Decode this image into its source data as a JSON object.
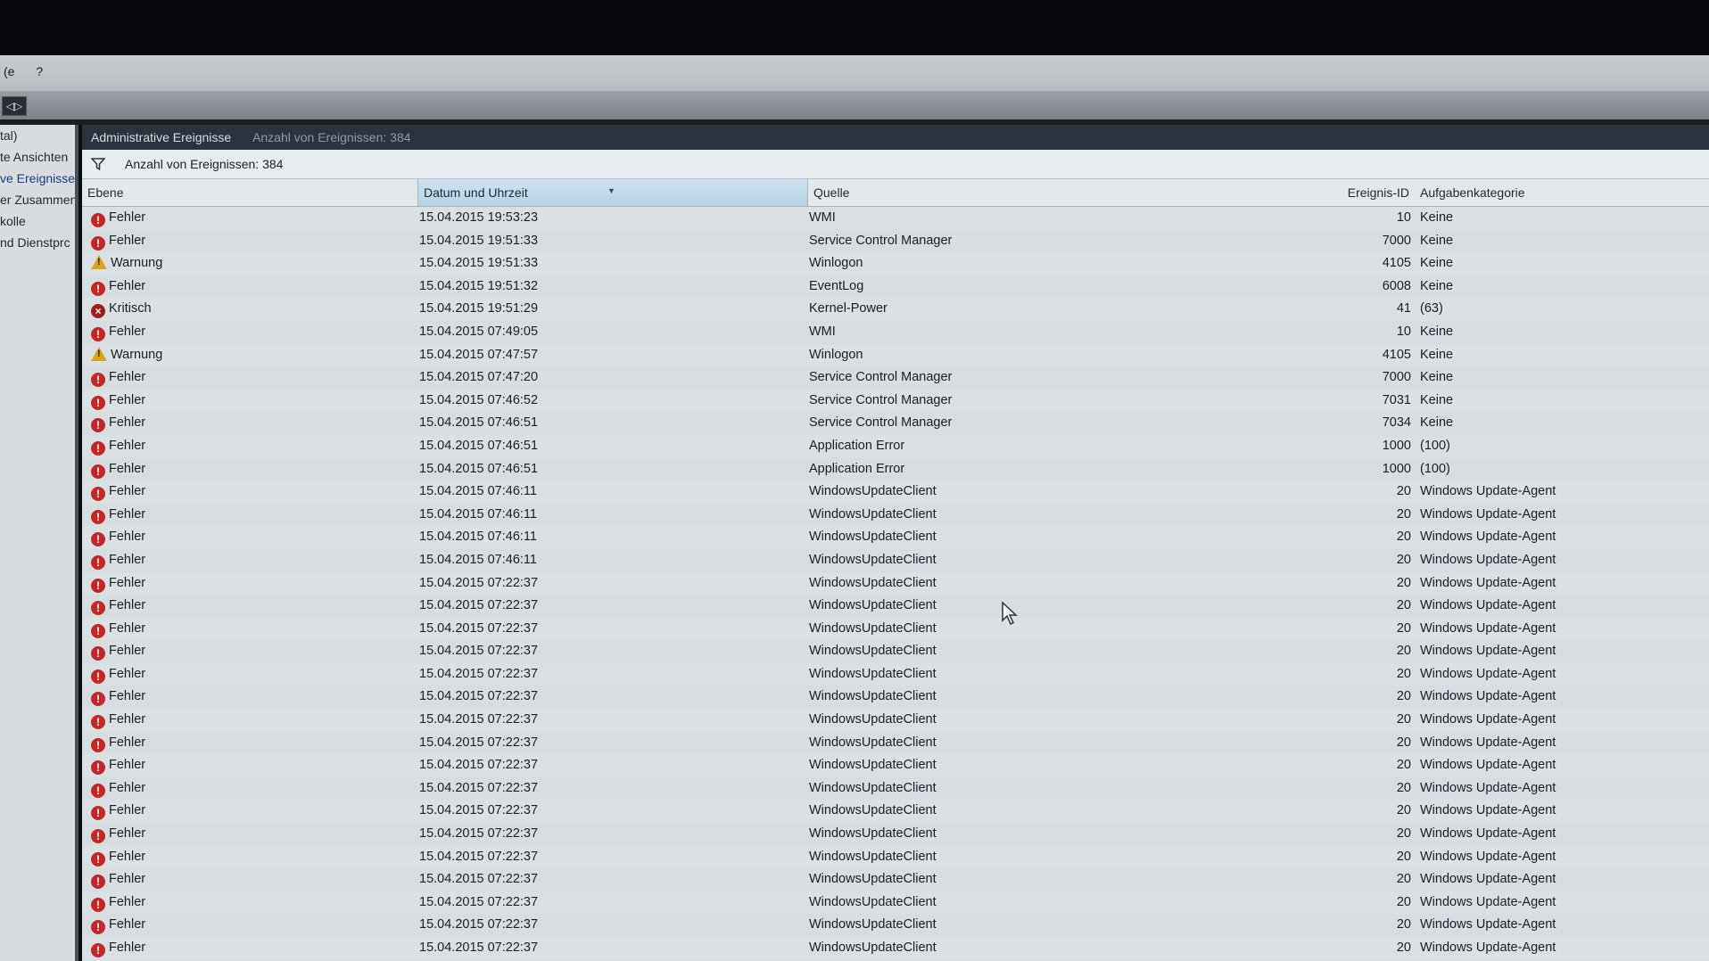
{
  "menubar": {
    "items": [
      "(e",
      "?"
    ]
  },
  "toolbar": {
    "button_label": "◁▷"
  },
  "sidebar": {
    "items": [
      {
        "label": "tal)"
      },
      {
        "label": "te Ansichten"
      },
      {
        "label": "ve Ereignisse"
      },
      {
        "label": "er Zusammen"
      },
      {
        "label": "kolle"
      },
      {
        "label": "nd Dienstprc"
      }
    ]
  },
  "header": {
    "title": "Administrative Ereignisse",
    "subtitle": "Anzahl von Ereignissen: 384"
  },
  "filter": {
    "count_text": "Anzahl von Ereignissen: 384"
  },
  "columns": {
    "level": "Ebene",
    "date": "Datum und Uhrzeit",
    "source": "Quelle",
    "id": "Ereignis-ID",
    "category": "Aufgabenkategorie"
  },
  "level_icons": {
    "Fehler": "error-icon",
    "Warnung": "warning-icon",
    "Kritisch": "critical-icon"
  },
  "colors": {
    "error": "#c0282a",
    "warning": "#d9a520",
    "critical": "#9a1f1f",
    "sorted_header": "#b4d2e4"
  },
  "rows": [
    {
      "level": "Fehler",
      "date": "15.04.2015 19:53:23",
      "source": "WMI",
      "id": "10",
      "category": "Keine"
    },
    {
      "level": "Fehler",
      "date": "15.04.2015 19:51:33",
      "source": "Service Control Manager",
      "id": "7000",
      "category": "Keine"
    },
    {
      "level": "Warnung",
      "date": "15.04.2015 19:51:33",
      "source": "Winlogon",
      "id": "4105",
      "category": "Keine"
    },
    {
      "level": "Fehler",
      "date": "15.04.2015 19:51:32",
      "source": "EventLog",
      "id": "6008",
      "category": "Keine"
    },
    {
      "level": "Kritisch",
      "date": "15.04.2015 19:51:29",
      "source": "Kernel-Power",
      "id": "41",
      "category": "(63)"
    },
    {
      "level": "Fehler",
      "date": "15.04.2015 07:49:05",
      "source": "WMI",
      "id": "10",
      "category": "Keine"
    },
    {
      "level": "Warnung",
      "date": "15.04.2015 07:47:57",
      "source": "Winlogon",
      "id": "4105",
      "category": "Keine"
    },
    {
      "level": "Fehler",
      "date": "15.04.2015 07:47:20",
      "source": "Service Control Manager",
      "id": "7000",
      "category": "Keine"
    },
    {
      "level": "Fehler",
      "date": "15.04.2015 07:46:52",
      "source": "Service Control Manager",
      "id": "7031",
      "category": "Keine"
    },
    {
      "level": "Fehler",
      "date": "15.04.2015 07:46:51",
      "source": "Service Control Manager",
      "id": "7034",
      "category": "Keine"
    },
    {
      "level": "Fehler",
      "date": "15.04.2015 07:46:51",
      "source": "Application Error",
      "id": "1000",
      "category": "(100)"
    },
    {
      "level": "Fehler",
      "date": "15.04.2015 07:46:51",
      "source": "Application Error",
      "id": "1000",
      "category": "(100)"
    },
    {
      "level": "Fehler",
      "date": "15.04.2015 07:46:11",
      "source": "WindowsUpdateClient",
      "id": "20",
      "category": "Windows Update-Agent"
    },
    {
      "level": "Fehler",
      "date": "15.04.2015 07:46:11",
      "source": "WindowsUpdateClient",
      "id": "20",
      "category": "Windows Update-Agent"
    },
    {
      "level": "Fehler",
      "date": "15.04.2015 07:46:11",
      "source": "WindowsUpdateClient",
      "id": "20",
      "category": "Windows Update-Agent"
    },
    {
      "level": "Fehler",
      "date": "15.04.2015 07:46:11",
      "source": "WindowsUpdateClient",
      "id": "20",
      "category": "Windows Update-Agent"
    },
    {
      "level": "Fehler",
      "date": "15.04.2015 07:22:37",
      "source": "WindowsUpdateClient",
      "id": "20",
      "category": "Windows Update-Agent"
    },
    {
      "level": "Fehler",
      "date": "15.04.2015 07:22:37",
      "source": "WindowsUpdateClient",
      "id": "20",
      "category": "Windows Update-Agent"
    },
    {
      "level": "Fehler",
      "date": "15.04.2015 07:22:37",
      "source": "WindowsUpdateClient",
      "id": "20",
      "category": "Windows Update-Agent"
    },
    {
      "level": "Fehler",
      "date": "15.04.2015 07:22:37",
      "source": "WindowsUpdateClient",
      "id": "20",
      "category": "Windows Update-Agent"
    },
    {
      "level": "Fehler",
      "date": "15.04.2015 07:22:37",
      "source": "WindowsUpdateClient",
      "id": "20",
      "category": "Windows Update-Agent"
    },
    {
      "level": "Fehler",
      "date": "15.04.2015 07:22:37",
      "source": "WindowsUpdateClient",
      "id": "20",
      "category": "Windows Update-Agent"
    },
    {
      "level": "Fehler",
      "date": "15.04.2015 07:22:37",
      "source": "WindowsUpdateClient",
      "id": "20",
      "category": "Windows Update-Agent"
    },
    {
      "level": "Fehler",
      "date": "15.04.2015 07:22:37",
      "source": "WindowsUpdateClient",
      "id": "20",
      "category": "Windows Update-Agent"
    },
    {
      "level": "Fehler",
      "date": "15.04.2015 07:22:37",
      "source": "WindowsUpdateClient",
      "id": "20",
      "category": "Windows Update-Agent"
    },
    {
      "level": "Fehler",
      "date": "15.04.2015 07:22:37",
      "source": "WindowsUpdateClient",
      "id": "20",
      "category": "Windows Update-Agent"
    },
    {
      "level": "Fehler",
      "date": "15.04.2015 07:22:37",
      "source": "WindowsUpdateClient",
      "id": "20",
      "category": "Windows Update-Agent"
    },
    {
      "level": "Fehler",
      "date": "15.04.2015 07:22:37",
      "source": "WindowsUpdateClient",
      "id": "20",
      "category": "Windows Update-Agent"
    },
    {
      "level": "Fehler",
      "date": "15.04.2015 07:22:37",
      "source": "WindowsUpdateClient",
      "id": "20",
      "category": "Windows Update-Agent"
    },
    {
      "level": "Fehler",
      "date": "15.04.2015 07:22:37",
      "source": "WindowsUpdateClient",
      "id": "20",
      "category": "Windows Update-Agent"
    },
    {
      "level": "Fehler",
      "date": "15.04.2015 07:22:37",
      "source": "WindowsUpdateClient",
      "id": "20",
      "category": "Windows Update-Agent"
    },
    {
      "level": "Fehler",
      "date": "15.04.2015 07:22:37",
      "source": "WindowsUpdateClient",
      "id": "20",
      "category": "Windows Update-Agent"
    },
    {
      "level": "Fehler",
      "date": "15.04.2015 07:22:37",
      "source": "WindowsUpdateClient",
      "id": "20",
      "category": "Windows Update-Agent"
    }
  ]
}
